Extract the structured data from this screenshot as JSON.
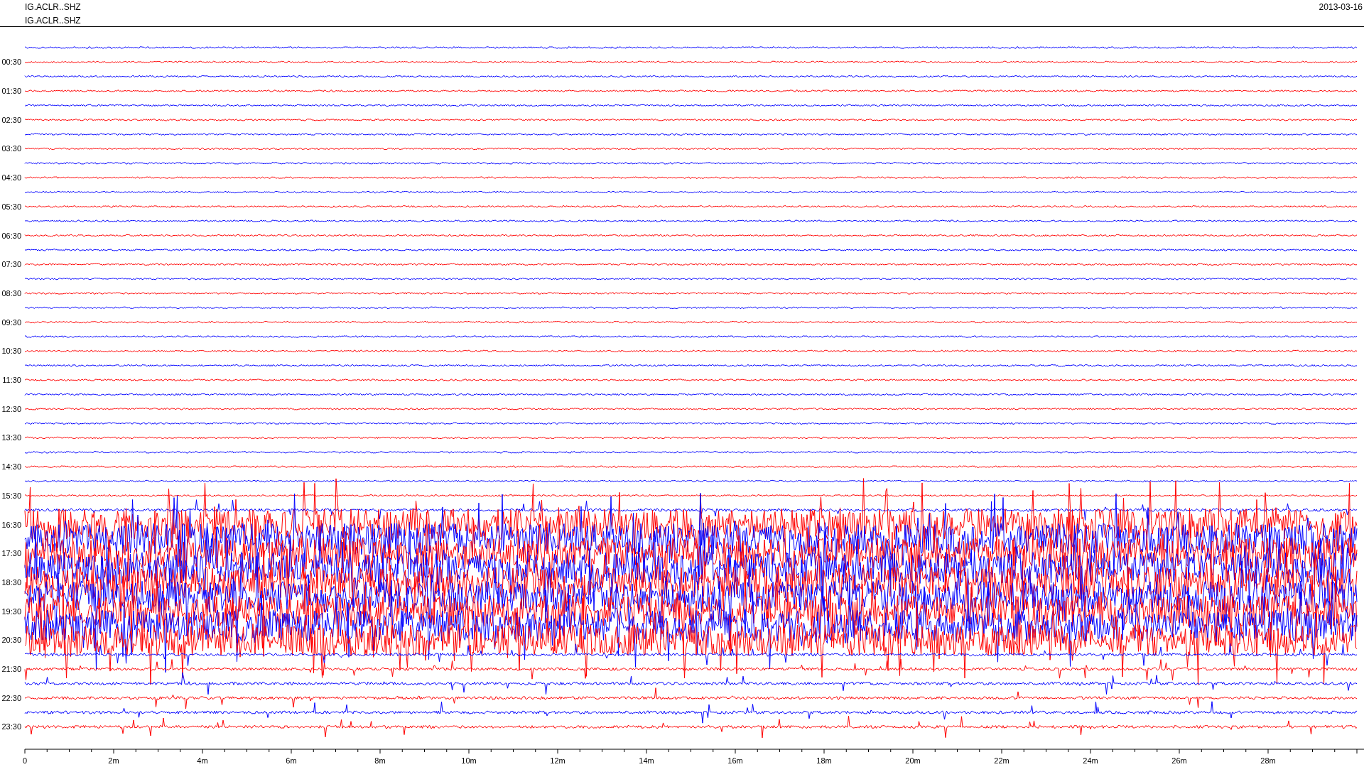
{
  "header": {
    "station_lines": [
      "IG.ACLR..SHZ",
      "IG.ACLR..SHZ"
    ],
    "date": "2013-03-16"
  },
  "traces": [
    {
      "color": "#0000ff",
      "kind": "quiet"
    },
    {
      "label": "00:30",
      "color": "#ff0000",
      "kind": "quiet"
    },
    {
      "color": "#0000ff",
      "kind": "quiet"
    },
    {
      "label": "01:30",
      "color": "#ff0000",
      "kind": "quiet"
    },
    {
      "color": "#0000ff",
      "kind": "quiet"
    },
    {
      "label": "02:30",
      "color": "#ff0000",
      "kind": "quiet"
    },
    {
      "color": "#0000ff",
      "kind": "quiet"
    },
    {
      "label": "03:30",
      "color": "#ff0000",
      "kind": "quiet"
    },
    {
      "color": "#0000ff",
      "kind": "quiet"
    },
    {
      "label": "04:30",
      "color": "#ff0000",
      "kind": "quiet"
    },
    {
      "color": "#0000ff",
      "kind": "quiet"
    },
    {
      "label": "05:30",
      "color": "#ff0000",
      "kind": "quiet"
    },
    {
      "color": "#0000ff",
      "kind": "quiet"
    },
    {
      "label": "06:30",
      "color": "#ff0000",
      "kind": "quiet"
    },
    {
      "color": "#0000ff",
      "kind": "quiet"
    },
    {
      "label": "07:30",
      "color": "#ff0000",
      "kind": "quiet"
    },
    {
      "color": "#0000ff",
      "kind": "quiet"
    },
    {
      "label": "08:30",
      "color": "#ff0000",
      "kind": "quiet"
    },
    {
      "color": "#0000ff",
      "kind": "quiet"
    },
    {
      "label": "09:30",
      "color": "#ff0000",
      "kind": "quiet"
    },
    {
      "color": "#0000ff",
      "kind": "quiet"
    },
    {
      "label": "10:30",
      "color": "#ff0000",
      "kind": "quiet"
    },
    {
      "color": "#0000ff",
      "kind": "quiet"
    },
    {
      "label": "11:30",
      "color": "#ff0000",
      "kind": "quiet"
    },
    {
      "color": "#0000ff",
      "kind": "quiet"
    },
    {
      "label": "12:30",
      "color": "#ff0000",
      "kind": "quiet"
    },
    {
      "color": "#0000ff",
      "kind": "quiet"
    },
    {
      "label": "13:30",
      "color": "#ff0000",
      "kind": "quiet"
    },
    {
      "color": "#0000ff",
      "kind": "quiet"
    },
    {
      "label": "14:30",
      "color": "#ff0000",
      "kind": "quiet"
    },
    {
      "color": "#0000ff",
      "kind": "quiet"
    },
    {
      "label": "15:30",
      "color": "#ff0000",
      "kind": "quiet"
    },
    {
      "color": "#0000ff",
      "kind": "moderate"
    },
    {
      "label": "16:30",
      "color": "#ff0000",
      "kind": "heavy"
    },
    {
      "color": "#0000ff",
      "kind": "heavy"
    },
    {
      "label": "17:30",
      "color": "#ff0000",
      "kind": "heavy"
    },
    {
      "color": "#0000ff",
      "kind": "heavy"
    },
    {
      "label": "18:30",
      "color": "#ff0000",
      "kind": "heavy"
    },
    {
      "color": "#0000ff",
      "kind": "heavy"
    },
    {
      "label": "19:30",
      "color": "#ff0000",
      "kind": "heavy"
    },
    {
      "color": "#0000ff",
      "kind": "heavy"
    },
    {
      "label": "20:30",
      "color": "#ff0000",
      "kind": "heavy"
    },
    {
      "color": "#0000ff",
      "kind": "moderate"
    },
    {
      "label": "21:30",
      "color": "#ff0000",
      "kind": "moderate"
    },
    {
      "color": "#0000ff",
      "kind": "moderate"
    },
    {
      "label": "22:30",
      "color": "#ff0000",
      "kind": "moderate"
    },
    {
      "color": "#0000ff",
      "kind": "moderate"
    },
    {
      "label": "23:30",
      "color": "#ff0000",
      "kind": "moderate"
    }
  ],
  "x_axis": {
    "tick_labels": [
      "0",
      "2m",
      "4m",
      "6m",
      "8m",
      "10m",
      "12m",
      "14m",
      "16m",
      "18m",
      "20m",
      "22m",
      "24m",
      "26m",
      "28m"
    ]
  }
}
